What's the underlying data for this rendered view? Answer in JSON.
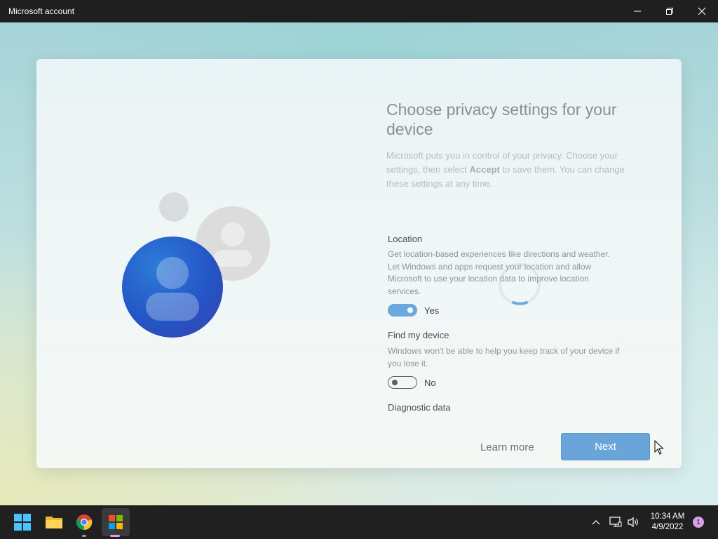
{
  "window": {
    "title": "Microsoft account",
    "minimize_icon": "minimize-icon",
    "restore_icon": "restore-icon",
    "close_icon": "close-icon"
  },
  "page": {
    "heading": "Choose privacy settings for your device",
    "intro_before": "Microsoft puts you in control of your privacy. Choose your settings, then select ",
    "intro_bold": "Accept",
    "intro_after": " to save them. You can change these settings at any time.",
    "sections": [
      {
        "title": "Location",
        "description": "Get location-based experiences like directions and weather. Let Windows and apps request your location and allow Microsoft to use your location data to improve location services.",
        "toggle_state": "on",
        "toggle_label": "Yes"
      },
      {
        "title": "Find my device",
        "description": "Windows won't be able to help you keep track of your device if you lose it.",
        "toggle_state": "off",
        "toggle_label": "No"
      },
      {
        "title": "Diagnostic data"
      }
    ],
    "learn_more": "Learn more",
    "next": "Next"
  },
  "taskbar": {
    "icons": [
      "windows-start-icon",
      "file-explorer-icon",
      "chrome-icon",
      "microsoft-store-icon"
    ],
    "tray_icons": [
      "chevron-up-icon",
      "network-icon",
      "volume-icon"
    ],
    "time": "10:34 AM",
    "date": "4/9/2022",
    "notification_count": "1"
  },
  "colors": {
    "accent": "#6aa5da",
    "titlebar": "#1f1f1f",
    "taskbar": "#202020"
  }
}
